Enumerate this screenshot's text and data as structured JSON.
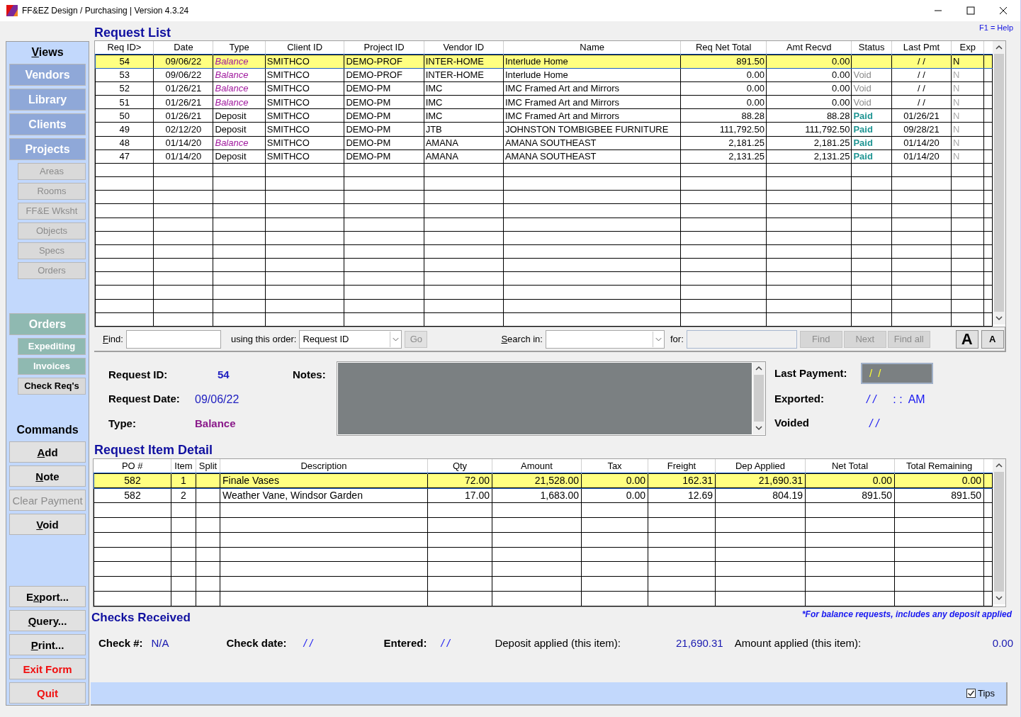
{
  "window": {
    "title": "FF&EZ Design / Purchasing | Version 4.3.24"
  },
  "help_hint": "F1 = Help",
  "sidebar": {
    "views_title": {
      "key": "V",
      "post": "iews"
    },
    "views": [
      {
        "label": "Vendors",
        "kind": "main",
        "color": "#8fa8d8",
        "disabled": false,
        "selected": false
      },
      {
        "label": "Library",
        "kind": "main",
        "color": "#8fa8d8",
        "disabled": false,
        "selected": false
      },
      {
        "label": "Clients",
        "kind": "main",
        "color": "#8fa8d8",
        "disabled": false,
        "selected": false
      },
      {
        "label": "Projects",
        "kind": "main",
        "color": "#8fa8d8",
        "disabled": false,
        "selected": false
      },
      {
        "label": "Areas",
        "kind": "sub",
        "disabled": true,
        "selected": false
      },
      {
        "label": "Rooms",
        "kind": "sub",
        "disabled": true,
        "selected": false
      },
      {
        "label": "FF&E Wksht",
        "kind": "sub",
        "disabled": true,
        "selected": false
      },
      {
        "label": "Objects",
        "kind": "sub",
        "disabled": true,
        "selected": false
      },
      {
        "label": "Specs",
        "kind": "sub",
        "disabled": true,
        "selected": false
      },
      {
        "label": "Orders",
        "kind": "sub",
        "disabled": true,
        "selected": false
      },
      {
        "label": "Orders",
        "kind": "main",
        "color": "#8fb9b1",
        "disabled": false,
        "selected": false
      },
      {
        "label": "Expediting",
        "kind": "sub",
        "color": "#8fb9b1",
        "disabled": false,
        "selected": false
      },
      {
        "label": "Invoices",
        "kind": "sub",
        "color": "#8fb9b1",
        "disabled": false,
        "selected": false
      },
      {
        "label": "Check Req's",
        "kind": "sub",
        "disabled": false,
        "selected": true
      }
    ],
    "commands_title": "Commands",
    "commands": [
      {
        "label_parts": {
          "key": "A",
          "post": "dd"
        },
        "kind": "normal",
        "disabled": false
      },
      {
        "label_parts": {
          "key": "N",
          "post": "ote"
        },
        "kind": "normal",
        "disabled": false
      },
      {
        "label_parts": {
          "pre": "Clear Payment"
        },
        "kind": "normal",
        "disabled": true
      },
      {
        "label_parts": {
          "key": "V",
          "post": "oid"
        },
        "kind": "normal",
        "disabled": false
      }
    ],
    "bottom_commands": [
      {
        "label_parts": {
          "pre": "E",
          "key": "x",
          "post": "port..."
        },
        "kind": "normal",
        "disabled": false
      },
      {
        "label_parts": {
          "key": "Q",
          "post": "uery..."
        },
        "kind": "normal",
        "disabled": false
      },
      {
        "label_parts": {
          "key": "P",
          "post": "rint..."
        },
        "kind": "normal",
        "disabled": false
      },
      {
        "label_parts": {
          "pre": "Exit Form"
        },
        "kind": "danger",
        "disabled": false
      },
      {
        "label_parts": {
          "pre": "Quit"
        },
        "kind": "danger",
        "disabled": false
      }
    ]
  },
  "request_list": {
    "title": "Request List",
    "columns": [
      "Req ID>",
      "Date",
      "Type",
      "Client ID",
      "Project ID",
      "Vendor ID",
      "Name",
      "Req Net Total",
      "Amt Recvd",
      "Status",
      "Last Pmt",
      "Exp"
    ],
    "rows": [
      {
        "selected": true,
        "cells": [
          "54",
          "09/06/22",
          {
            "text": "Balance",
            "kind": "balance"
          },
          "SMITHCO",
          "DEMO-PROF",
          "INTER-HOME",
          "Interlude Home",
          "891.50",
          "0.00",
          null,
          "/ /",
          "N"
        ]
      },
      {
        "selected": false,
        "cells": [
          "53",
          "09/06/22",
          {
            "text": "Balance",
            "kind": "balance"
          },
          "SMITHCO",
          "DEMO-PROF",
          "INTER-HOME",
          "Interlude Home",
          "0.00",
          "0.00",
          {
            "text": "Void",
            "kind": "void"
          },
          "/ /",
          "N"
        ]
      },
      {
        "selected": false,
        "cells": [
          "52",
          "01/26/21",
          {
            "text": "Balance",
            "kind": "balance"
          },
          "SMITHCO",
          "DEMO-PM",
          "IMC",
          "IMC Framed Art and Mirrors",
          "0.00",
          "0.00",
          {
            "text": "Void",
            "kind": "void"
          },
          "/ /",
          "N"
        ]
      },
      {
        "selected": false,
        "cells": [
          "51",
          "01/26/21",
          {
            "text": "Balance",
            "kind": "balance"
          },
          "SMITHCO",
          "DEMO-PM",
          "IMC",
          "IMC Framed Art and Mirrors",
          "0.00",
          "0.00",
          {
            "text": "Void",
            "kind": "void"
          },
          "/ /",
          "N"
        ]
      },
      {
        "selected": false,
        "cells": [
          "50",
          "01/26/21",
          {
            "text": "Deposit",
            "kind": "deposit"
          },
          "SMITHCO",
          "DEMO-PM",
          "IMC",
          "IMC Framed Art and Mirrors",
          "88.28",
          "88.28",
          {
            "text": "Paid",
            "kind": "paid"
          },
          "01/26/21",
          "N"
        ]
      },
      {
        "selected": false,
        "cells": [
          "49",
          "02/12/20",
          {
            "text": "Deposit",
            "kind": "deposit"
          },
          "SMITHCO",
          "DEMO-PM",
          "JTB",
          "JOHNSTON TOMBIGBEE FURNITURE",
          "111,792.50",
          "111,792.50",
          {
            "text": "Paid",
            "kind": "paid"
          },
          "09/28/21",
          "N"
        ]
      },
      {
        "selected": false,
        "cells": [
          "48",
          "01/14/20",
          {
            "text": "Balance",
            "kind": "balance"
          },
          "SMITHCO",
          "DEMO-PM",
          "AMANA",
          "AMANA SOUTHEAST",
          "2,181.25",
          "2,181.25",
          {
            "text": "Paid",
            "kind": "paid"
          },
          "01/14/20",
          "N"
        ]
      },
      {
        "selected": false,
        "cells": [
          "47",
          "01/14/20",
          {
            "text": "Deposit",
            "kind": "deposit"
          },
          "SMITHCO",
          "DEMO-PM",
          "AMANA",
          "AMANA SOUTHEAST",
          "2,131.25",
          "2,131.25",
          {
            "text": "Paid",
            "kind": "paid"
          },
          "01/14/20",
          "N"
        ]
      }
    ]
  },
  "find_bar": {
    "find_label": {
      "key": "F",
      "post": "ind:"
    },
    "order_label": "using this order:",
    "order_value": "Request ID",
    "go": "Go",
    "search_label": {
      "key": "S",
      "post": "earch in:"
    },
    "for_label": "for:",
    "find": "Find",
    "next": "Next",
    "find_all": "Find all",
    "font_large": "A",
    "font_small": "A"
  },
  "details": {
    "request_id_label": "Request ID:",
    "request_id": "54",
    "request_date_label": "Request Date:",
    "request_date": "09/06/22",
    "type_label": "Type:",
    "type": "Balance",
    "notes_label": "Notes:",
    "last_payment_label": "Last Payment:",
    "last_payment": "/ /",
    "exported_label": "Exported:",
    "exported_date": "/ /",
    "exported_time": ": :",
    "exported_ampm": "AM",
    "voided_label": "Voided",
    "voided": "/ /"
  },
  "item_detail": {
    "title": "Request Item Detail",
    "columns": [
      "PO #",
      "Item",
      "Split",
      "Description",
      "Qty",
      "Amount",
      "Tax",
      "Freight",
      "Dep Applied",
      "Net Total",
      "Total Remaining"
    ],
    "rows": [
      {
        "selected": true,
        "cells": [
          "582",
          "1",
          null,
          "Finale Vases",
          "72.00",
          "21,528.00",
          "0.00",
          "162.31",
          "21,690.31",
          "0.00",
          "0.00"
        ]
      },
      {
        "selected": false,
        "cells": [
          "582",
          "2",
          null,
          "Weather Vane, Windsor Garden",
          "17.00",
          "1,683.00",
          "0.00",
          "12.69",
          "804.19",
          "891.50",
          "891.50"
        ]
      }
    ],
    "footnote": "*For balance requests, includes any deposit applied"
  },
  "checks": {
    "title": "Checks Received",
    "check_no_label": "Check #:",
    "check_no": "N/A",
    "check_date_label": "Check date:",
    "check_date": "/ /",
    "entered_label": "Entered:",
    "entered": "/ /",
    "deposit_label": "Deposit applied (this item):",
    "deposit": "21,690.31",
    "amount_label": "Amount applied (this item):",
    "amount": "0.00"
  },
  "status_bar": {
    "tips_label": "Tips",
    "tips_checked": true
  }
}
